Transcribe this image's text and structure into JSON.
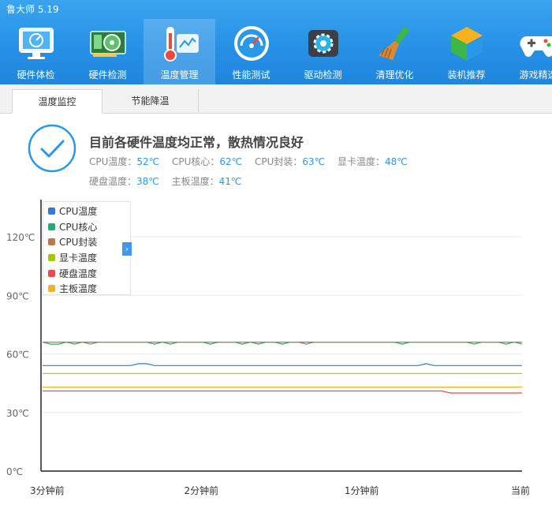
{
  "app": {
    "title": "鲁大师 5.19"
  },
  "nav": [
    {
      "label": "硬件体检",
      "icon": "monitor-icon"
    },
    {
      "label": "硬件检测",
      "icon": "graphics-card-icon"
    },
    {
      "label": "温度管理",
      "icon": "thermometer-icon",
      "active": true
    },
    {
      "label": "性能测试",
      "icon": "speedometer-icon"
    },
    {
      "label": "驱动检测",
      "icon": "driver-gear-icon"
    },
    {
      "label": "清理优化",
      "icon": "broom-icon"
    },
    {
      "label": "装机推荐",
      "icon": "cube-icon"
    },
    {
      "label": "游戏精选",
      "icon": "gamepad-icon"
    }
  ],
  "tabs": [
    {
      "label": "温度监控",
      "active": true
    },
    {
      "label": "节能降温"
    }
  ],
  "status": {
    "message": "目前各硬件温度均正常，散热情况良好",
    "readings": [
      {
        "label": "CPU温度：",
        "value": "52℃"
      },
      {
        "label": "CPU核心：",
        "value": "62℃"
      },
      {
        "label": "CPU封装：",
        "value": "63℃"
      },
      {
        "label": "显卡温度：",
        "value": "48℃"
      },
      {
        "label": "硬盘温度：",
        "value": "38℃"
      },
      {
        "label": "主板温度：",
        "value": "41℃"
      }
    ]
  },
  "colors": {
    "accent": "#2a98e8",
    "header": "#2791e6"
  },
  "chart_data": {
    "type": "line",
    "ylim": [
      0,
      120
    ],
    "y_ticks": [
      {
        "value": 0,
        "label": "0℃"
      },
      {
        "value": 30,
        "label": "30℃"
      },
      {
        "value": 60,
        "label": "60℃"
      },
      {
        "value": 90,
        "label": "90℃"
      },
      {
        "value": 120,
        "label": "120℃"
      }
    ],
    "x_ticks": [
      "3分钟前",
      "2分钟前",
      "1分钟前",
      "当前"
    ],
    "grid": true,
    "legend_position": "top-left",
    "series": [
      {
        "name": "CPU温度",
        "color": "#2b7be0",
        "values": [
          54,
          54,
          54,
          54,
          54,
          54,
          54,
          54,
          54,
          54,
          54,
          54,
          55,
          55,
          54,
          54,
          54,
          54,
          54,
          54,
          54,
          54,
          54,
          54,
          54,
          54,
          54,
          54,
          54,
          54,
          54,
          54,
          54,
          54,
          54,
          54,
          54,
          54,
          54,
          54,
          54,
          54,
          54,
          54,
          54,
          54,
          54,
          54,
          55,
          54,
          54,
          54,
          54,
          54,
          54,
          54,
          54,
          54,
          54,
          54,
          54
        ]
      },
      {
        "name": "CPU核心",
        "color": "#1fae71",
        "values": [
          66,
          65,
          65,
          66,
          65,
          66,
          66,
          66,
          66,
          66,
          66,
          66,
          66,
          66,
          65,
          66,
          65,
          66,
          66,
          66,
          66,
          65,
          66,
          66,
          66,
          65,
          66,
          65,
          66,
          66,
          65,
          66,
          66,
          66,
          66,
          66,
          66,
          66,
          66,
          66,
          66,
          66,
          66,
          66,
          66,
          65,
          66,
          66,
          66,
          66,
          66,
          66,
          66,
          66,
          65,
          66,
          66,
          66,
          65,
          66,
          65
        ]
      },
      {
        "name": "CPU封装",
        "color": "#b87a4e",
        "values": [
          66,
          66,
          66,
          66,
          66,
          66,
          65,
          66,
          66,
          66,
          66,
          66,
          66,
          66,
          66,
          66,
          66,
          66,
          66,
          66,
          66,
          66,
          66,
          66,
          66,
          66,
          66,
          66,
          66,
          66,
          66,
          66,
          66,
          65,
          66,
          66,
          66,
          66,
          66,
          66,
          66,
          66,
          66,
          66,
          66,
          66,
          66,
          66,
          66,
          66,
          66,
          66,
          66,
          66,
          66,
          66,
          66,
          66,
          66,
          66,
          66
        ]
      },
      {
        "name": "显卡温度",
        "color": "#a4c800",
        "values": [
          50,
          50,
          50,
          50,
          50,
          50,
          50,
          50,
          50,
          50,
          50,
          50,
          50,
          50,
          50,
          50,
          50,
          50,
          50,
          50,
          50,
          50,
          50,
          50,
          50,
          50,
          50,
          50,
          50,
          50,
          50,
          50,
          50,
          50,
          50,
          50,
          50,
          50,
          50,
          50,
          50,
          50,
          50,
          50,
          50,
          50,
          50,
          50,
          50,
          50,
          50,
          50,
          50,
          50,
          50,
          50,
          50,
          50,
          50,
          50,
          50
        ]
      },
      {
        "name": "硬盘温度",
        "color": "#f04848",
        "values": [
          41,
          41,
          41,
          41,
          41,
          41,
          41,
          41,
          41,
          41,
          41,
          41,
          41,
          41,
          41,
          41,
          41,
          41,
          41,
          41,
          41,
          41,
          41,
          41,
          41,
          41,
          41,
          41,
          41,
          41,
          41,
          41,
          41,
          41,
          41,
          41,
          41,
          41,
          41,
          41,
          41,
          41,
          41,
          41,
          41,
          41,
          41,
          41,
          41,
          41,
          41,
          40,
          40,
          40,
          40,
          40,
          40,
          40,
          40,
          40,
          40
        ]
      },
      {
        "name": "主板温度",
        "color": "#f5b21d",
        "values": [
          43,
          43,
          43,
          43,
          43,
          43,
          43,
          43,
          43,
          43,
          43,
          43,
          43,
          43,
          43,
          43,
          43,
          43,
          43,
          43,
          43,
          43,
          43,
          43,
          43,
          43,
          43,
          43,
          43,
          43,
          43,
          43,
          43,
          43,
          43,
          43,
          43,
          43,
          43,
          43,
          43,
          43,
          43,
          43,
          43,
          43,
          43,
          43,
          43,
          43,
          43,
          43,
          43,
          43,
          43,
          43,
          43,
          43,
          43,
          43,
          43
        ]
      }
    ]
  }
}
